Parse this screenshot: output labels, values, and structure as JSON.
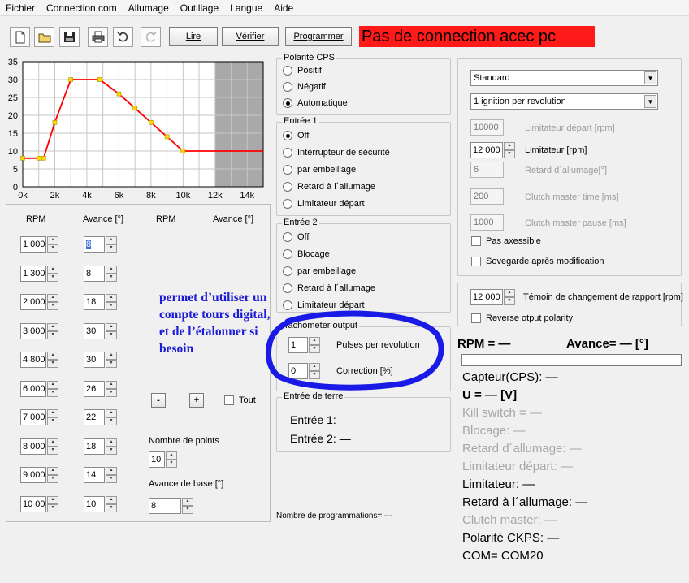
{
  "menu": [
    "Fichier",
    "Connection com",
    "Allumage",
    "Outillage",
    "Langue",
    "Aide"
  ],
  "toolbar": {
    "icons": [
      "new-file-icon",
      "open-folder-icon",
      "save-icon",
      "print-icon",
      "undo-icon",
      "redo-icon"
    ],
    "lire": "Lire",
    "verifier": "Vérifier",
    "programmer": "Programmer"
  },
  "banner": "Pas de connection acec pc",
  "chart_data": {
    "type": "line",
    "x": [
      0,
      1000,
      1300,
      2000,
      3000,
      4800,
      6000,
      7000,
      8000,
      9000,
      10000,
      15000
    ],
    "y": [
      8,
      8,
      8,
      18,
      30,
      30,
      26,
      22,
      18,
      14,
      10,
      10
    ],
    "xlim": [
      0,
      15000
    ],
    "ylim": [
      0,
      35
    ],
    "xticks": [
      "0k",
      "2k",
      "4k",
      "6k",
      "8k",
      "10k",
      "12k",
      "14k"
    ],
    "yticks": [
      "0",
      "5",
      "10",
      "15",
      "20",
      "25",
      "30",
      "35"
    ],
    "shaded_from": 12000,
    "grid": true,
    "line_color": "#ff0000",
    "marker_color": "#ffd800"
  },
  "table": {
    "headers": [
      "RPM",
      "Avance [°]",
      "RPM",
      "Avance [°]"
    ],
    "rows": [
      {
        "rpm": "1 000",
        "avance": "8"
      },
      {
        "rpm": "1 300",
        "avance": "8"
      },
      {
        "rpm": "2 000",
        "avance": "18"
      },
      {
        "rpm": "3 000",
        "avance": "30"
      },
      {
        "rpm": "4 800",
        "avance": "30"
      },
      {
        "rpm": "6 000",
        "avance": "26"
      },
      {
        "rpm": "7 000",
        "avance": "22"
      },
      {
        "rpm": "8 000",
        "avance": "18"
      },
      {
        "rpm": "9 000",
        "avance": "14"
      },
      {
        "rpm": "10 000",
        "avance": "10"
      }
    ],
    "minus": "-",
    "plus": "+",
    "tout": "Tout",
    "nb_points_label": "Nombre de points",
    "nb_points": "10",
    "avance_base_label": "Avance de base [°]",
    "avance_base": "8"
  },
  "annotation": "permet d’utiliser un compte tours digital, et de l’étalonner si besoin",
  "polarite": {
    "title": "Polarité CPS",
    "options": [
      "Positif",
      "Négatif",
      "Automatique"
    ],
    "selected": 2
  },
  "entree1": {
    "title": "Entrée 1",
    "options": [
      "Off",
      "Interrupteur de sécurité",
      "par embeillage",
      "Retard à l´allumage",
      "Limitateur départ"
    ],
    "selected": 0
  },
  "entree2": {
    "title": "Entrée 2",
    "options": [
      "Off",
      "Blocage",
      "par embeillage",
      "Retard à l´allumage",
      "Limitateur départ"
    ],
    "selected": -1
  },
  "tacho": {
    "title": "Tachometer output",
    "pulses_value": "1",
    "pulses_label": "Pulses per revolution",
    "correction_value": "0",
    "correction_label": "Correction [%]"
  },
  "terre": {
    "title": "Entrée de terre",
    "e1": "Entrée 1: —",
    "e2": "Entrée 2: —"
  },
  "nb_prog": "Nombre de programmations=  ---",
  "settings": {
    "select1": "Standard",
    "select2": "1 ignition per revolution",
    "lim_depart_value": "10000",
    "lim_depart_label": "Limitateur départ [rpm]",
    "limitateur_value": "12 000",
    "limitateur_label": "Limitateur [rpm]",
    "retard_value": "6",
    "retard_label": "Retard d´allumage[°]",
    "clutch_time_value": "200",
    "clutch_time_label": "Clutch master time [ms]",
    "clutch_pause_value": "1000",
    "clutch_pause_label": "Clutch master pause [ms]",
    "pas_axessible": "Pas axessible",
    "sovegarde": "Sovegarde après modification"
  },
  "gear": {
    "value": "12 000",
    "label": "Témoin de changement de rapport [rpm]",
    "reverse": "Reverse otput polarity"
  },
  "status": {
    "rpm": "RPM = —",
    "avance": "Avance= — [°]",
    "capteur": "Capteur(CPS): —",
    "u": "U = — [V]",
    "kill": "Kill switch = —",
    "blocage": "Blocage: —",
    "retard": "Retard d´allumage: —",
    "lim_depart": "Limitateur départ: —",
    "limitateur": "Limitateur: —",
    "retard2": "Retard à l´allumage: —",
    "clutch": "Clutch master: —",
    "polarite": "Polarité CKPS: —",
    "com": "COM= COM20"
  }
}
